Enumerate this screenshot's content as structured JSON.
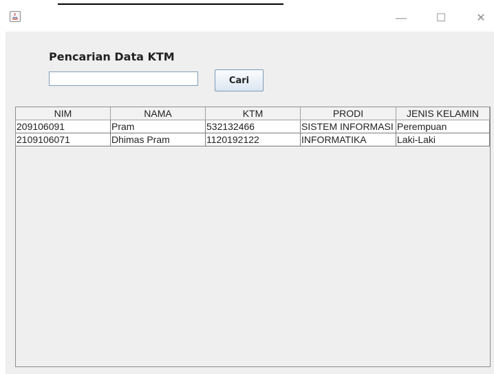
{
  "window": {
    "title": ""
  },
  "page": {
    "heading": "Pencarian Data KTM"
  },
  "search": {
    "value": "",
    "button_label": "Cari"
  },
  "table": {
    "columns": [
      "NIM",
      "NAMA",
      "KTM",
      "PRODI",
      "JENIS KELAMIN"
    ],
    "rows": [
      [
        "209106091",
        "Pram",
        "532132466",
        "SISTEM INFORMASI",
        "Perempuan"
      ],
      [
        "2109106071",
        "Dhimas Pram",
        "1120192122",
        "INFORMATIKA",
        "Laki-Laki"
      ]
    ]
  },
  "icons": {
    "app": "java-icon",
    "minimize": "minimize-icon",
    "maximize": "maximize-icon",
    "close": "close-icon"
  }
}
